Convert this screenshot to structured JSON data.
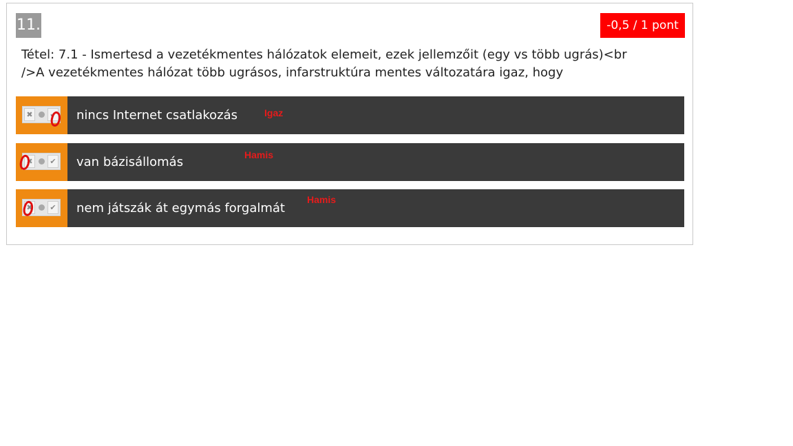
{
  "question": {
    "number": "11.",
    "score": "-0,5 / 1 pont",
    "text": "Tétel: 7.1 - Ismertesd a vezetékmentes hálózatok elemeit, ezek jellemzőit (egy vs több ugrás)<br />A vezetékmentes hálózat több ugrásos, infarstruktúra mentes változatára igaz, hogy"
  },
  "options": [
    {
      "label": "nincs Internet csatlakozás",
      "annotation": "Igaz",
      "left_icon": "x-icon",
      "right_icon": "check-icon"
    },
    {
      "label": "van bázisállomás",
      "annotation": "Hamis",
      "left_icon": "x-icon",
      "right_icon": "check-icon"
    },
    {
      "label": "nem játszák át egymás forgalmát",
      "annotation": "Hamis",
      "left_icon": "x-icon",
      "right_icon": "check-icon"
    }
  ],
  "colors": {
    "score_bg": "#ff0000",
    "option_bg": "#3a3a3a",
    "toggle_bg": "#ef8a12",
    "annotation": "#e61b1b"
  }
}
